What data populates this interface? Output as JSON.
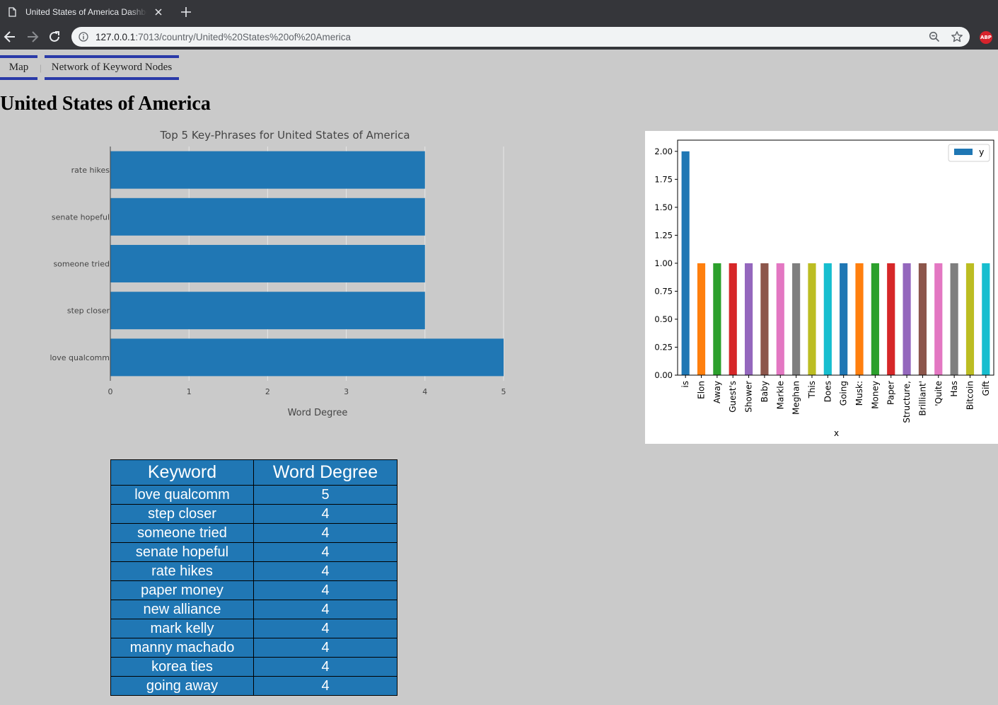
{
  "browser": {
    "tab_title": "United States of America Dashboard",
    "url_host": "127.0.0.1",
    "url_rest": ":7013/country/United%20States%20of%20America",
    "extension_label": "ABP"
  },
  "nav": {
    "links": [
      "Map",
      "Network of Keyword Nodes"
    ],
    "separator": "|"
  },
  "page": {
    "title": "United States of America"
  },
  "chart_data": [
    {
      "type": "bar",
      "orientation": "horizontal",
      "title": "Top 5 Key-Phrases for United States of America",
      "xlabel": "Word Degree",
      "ylabel": "",
      "categories": [
        "rate hikes",
        "senate hopeful",
        "someone tried",
        "step closer",
        "love qualcomm"
      ],
      "values": [
        4,
        4,
        4,
        4,
        5
      ],
      "xlim": [
        0,
        5
      ],
      "xticks": [
        0,
        1,
        2,
        3,
        4,
        5
      ],
      "bar_color": "#2077b4",
      "grid": true
    },
    {
      "type": "bar",
      "title": "",
      "xlabel": "x",
      "ylabel": "",
      "categories": [
        "is",
        "Elon",
        "Away",
        "Guest's",
        "Shower",
        "Baby",
        "Markle",
        "Meghan",
        "This",
        "Does",
        "Going",
        "Musk:",
        "Money",
        "Paper",
        "Structure,",
        "Brilliant'",
        "'Quite",
        "Has",
        "Bitcoin",
        "Gift"
      ],
      "series": [
        {
          "name": "y",
          "values": [
            2,
            1,
            1,
            1,
            1,
            1,
            1,
            1,
            1,
            1,
            1,
            1,
            1,
            1,
            1,
            1,
            1,
            1,
            1,
            1
          ]
        }
      ],
      "ylim": [
        0,
        2.1
      ],
      "yticks": [
        "0.00",
        "0.25",
        "0.50",
        "0.75",
        "1.00",
        "1.25",
        "1.50",
        "1.75",
        "2.00"
      ],
      "legend_position": "top-right",
      "colors": [
        "#1f77b4",
        "#ff7f0e",
        "#2ca02c",
        "#d62728",
        "#9467bd",
        "#8c564b",
        "#e377c2",
        "#7f7f7f",
        "#bcbd22",
        "#17becf"
      ]
    }
  ],
  "table": {
    "headers": [
      "Keyword",
      "Word Degree"
    ],
    "rows": [
      [
        "love qualcomm",
        "5"
      ],
      [
        "step closer",
        "4"
      ],
      [
        "someone tried",
        "4"
      ],
      [
        "senate hopeful",
        "4"
      ],
      [
        "rate hikes",
        "4"
      ],
      [
        "paper money",
        "4"
      ],
      [
        "new alliance",
        "4"
      ],
      [
        "mark kelly",
        "4"
      ],
      [
        "manny machado",
        "4"
      ],
      [
        "korea ties",
        "4"
      ],
      [
        "going away",
        "4"
      ]
    ]
  }
}
